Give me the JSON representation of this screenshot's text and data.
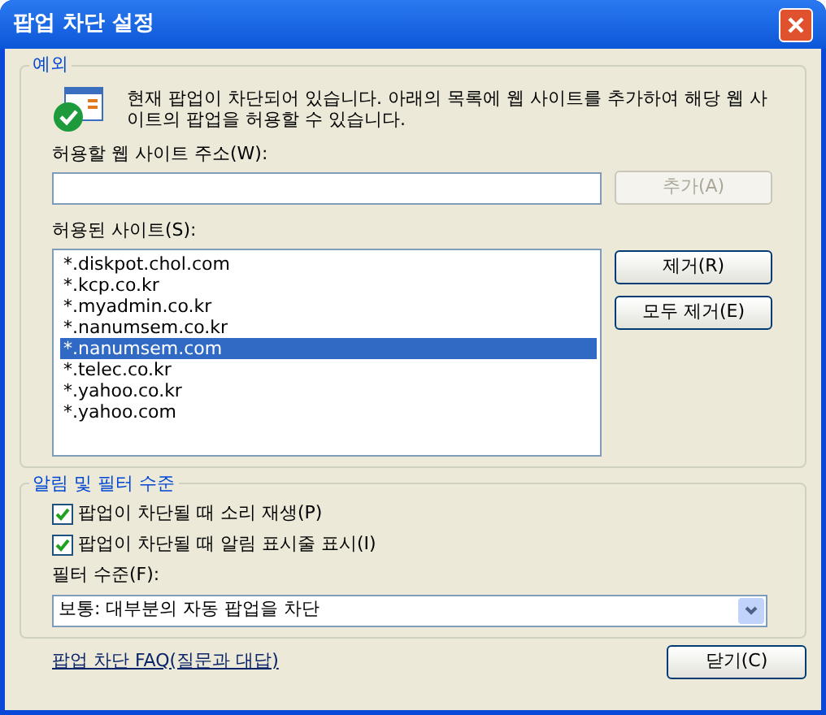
{
  "window": {
    "title": "팝업 차단 설정"
  },
  "exceptions": {
    "title": "예외",
    "description": "현재 팝업이 차단되어 있습니다. 아래의 목록에 웹 사이트를 추가하여 해당 웹 사이트의 팝업을 허용할 수 있습니다.",
    "address_label": "허용할 웹 사이트 주소(W):",
    "add_button": {
      "label": "추가(A)",
      "disabled": true
    },
    "list_label": "허용된 사이트(S):",
    "sites": [
      {
        "label": "*.diskpot.chol.com",
        "selected": false
      },
      {
        "label": "*.kcp.co.kr",
        "selected": false
      },
      {
        "label": "*.myadmin.co.kr",
        "selected": false
      },
      {
        "label": "*.nanumsem.co.kr",
        "selected": false
      },
      {
        "label": "*.nanumsem.com",
        "selected": true
      },
      {
        "label": "*.telec.co.kr",
        "selected": false
      },
      {
        "label": "*.yahoo.co.kr",
        "selected": false
      },
      {
        "label": "*.yahoo.com",
        "selected": false
      }
    ],
    "buttons": [
      {
        "label": "제거(R)",
        "disabled": false
      },
      {
        "label": "모두 제거(E)",
        "disabled": false
      }
    ]
  },
  "notifications": {
    "title": "알림 및 필터 수준",
    "options": [
      {
        "label": "팝업이 차단될 때 소리 재생(P)",
        "checked": true
      },
      {
        "label": "팝업이 차단될 때 알림 표시줄 표시(I)",
        "checked": true
      }
    ],
    "filter_label": "필터 수준(F):",
    "filter_value": "보통: 대부분의 자동 팝업을 차단"
  },
  "faq_link": "팝업 차단 FAQ(질문과 대답)",
  "close_button": "닫기(C)"
}
